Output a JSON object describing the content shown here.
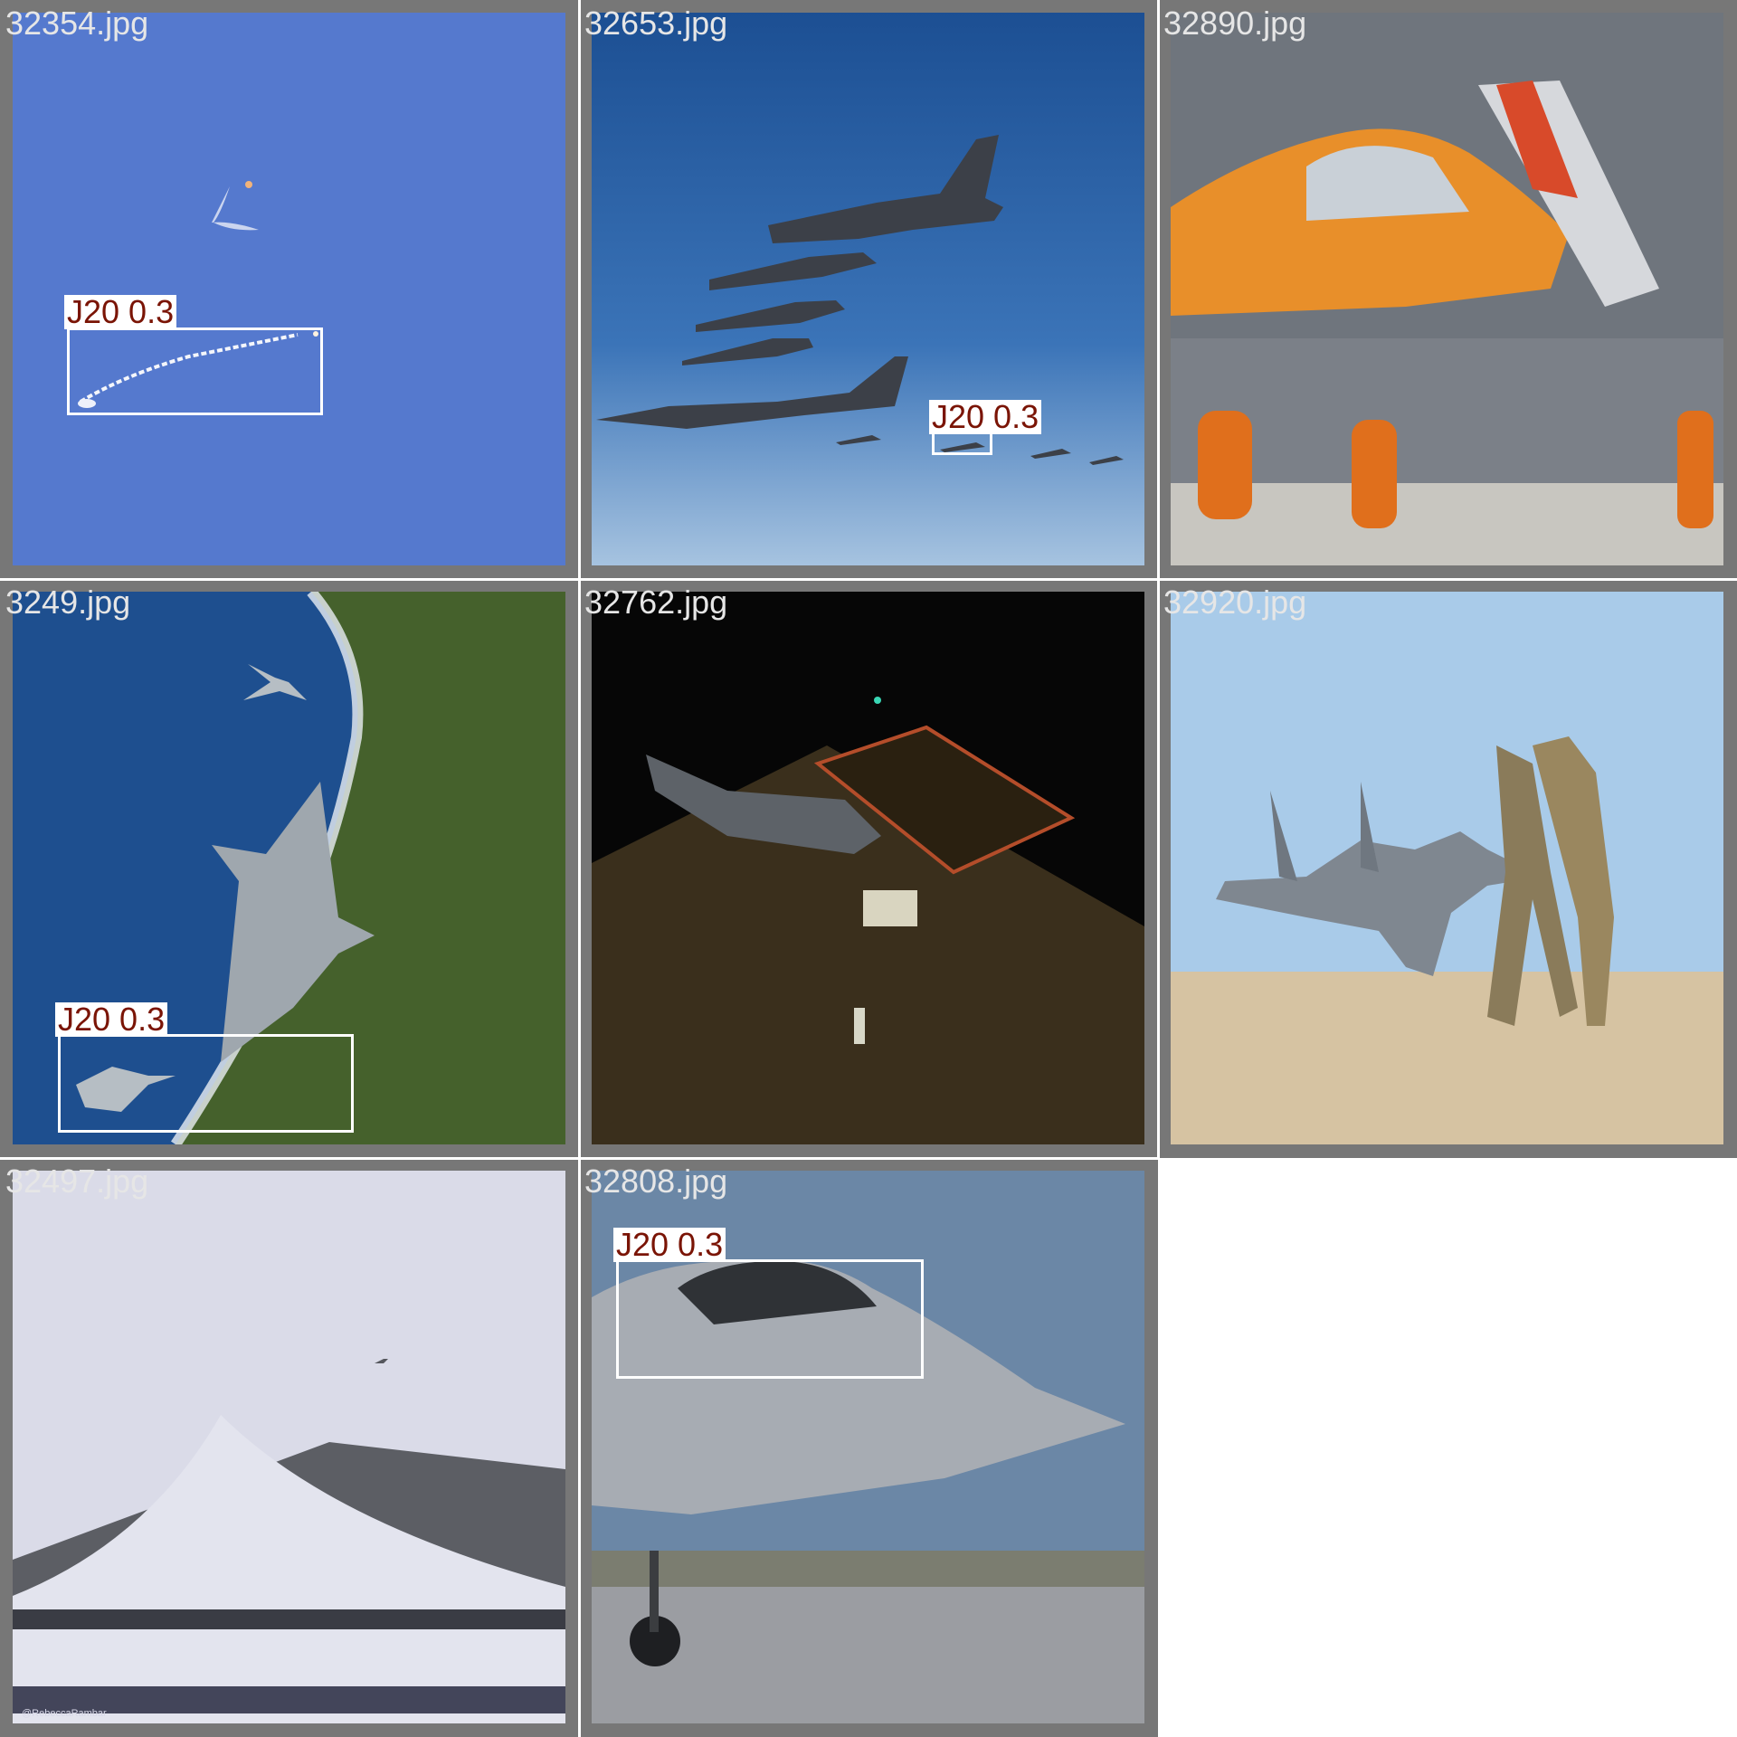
{
  "tiles": [
    {
      "filename": "32354.jpg",
      "detections": [
        {
          "label": "J20 0.3"
        }
      ]
    },
    {
      "filename": "32653.jpg",
      "detections": [
        {
          "label": "J20 0.3"
        }
      ]
    },
    {
      "filename": "32890.jpg",
      "detections": []
    },
    {
      "filename": "3249.jpg",
      "detections": [
        {
          "label": "J20 0.3"
        }
      ]
    },
    {
      "filename": "32762.jpg",
      "detections": []
    },
    {
      "filename": "32920.jpg",
      "detections": []
    },
    {
      "filename": "32497.jpg",
      "detections": [],
      "watermark": "@RebeccaRambar"
    },
    {
      "filename": "32808.jpg",
      "detections": [
        {
          "label": "J20 0.3"
        }
      ]
    }
  ],
  "colors": {
    "frame": "#777777",
    "box": "#ffffff",
    "label_text": "#7a1405",
    "filename_text": "#e6e6e6"
  }
}
